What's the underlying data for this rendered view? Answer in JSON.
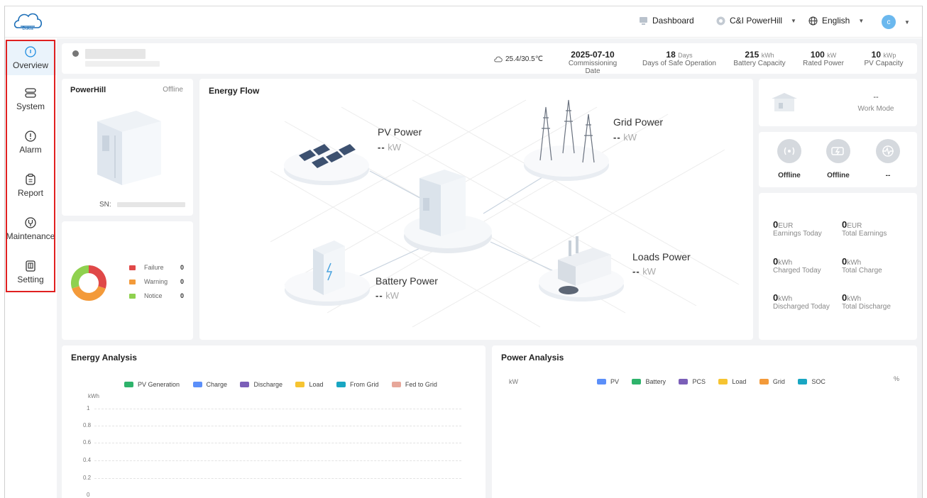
{
  "header": {
    "dashboard_label": "Dashboard",
    "site_label": "C&I PowerHill",
    "language_label": "English",
    "avatar_letter": "c",
    "accent": "#1d8ce0"
  },
  "sidebar": {
    "items": [
      {
        "label": "Overview",
        "icon": "home-icon"
      },
      {
        "label": "System",
        "icon": "system-icon"
      },
      {
        "label": "Alarm",
        "icon": "alarm-icon"
      },
      {
        "label": "Report",
        "icon": "report-icon"
      },
      {
        "label": "Maintenance",
        "icon": "maintenance-icon"
      },
      {
        "label": "Setting",
        "icon": "setting-icon"
      }
    ]
  },
  "info_bar": {
    "weather": "25.4/30.5℃",
    "commissioning_date": "2025-07-10",
    "commissioning_label": "Commissioning Date",
    "safe_days": "18",
    "safe_days_unit": "Days",
    "safe_days_label": "Days of Safe Operation",
    "battery_capacity": "215",
    "battery_capacity_unit": "kWh",
    "battery_capacity_label": "Battery Capacity",
    "rated_power": "100",
    "rated_power_unit": "kW",
    "rated_power_label": "Rated Power",
    "pv_capacity": "10",
    "pv_capacity_unit": "kWp",
    "pv_capacity_label": "PV Capacity"
  },
  "device": {
    "title": "PowerHill",
    "status": "Offline",
    "sn_label": "SN:"
  },
  "alarms": {
    "items": [
      {
        "label": "Failure",
        "count": "0",
        "color": "#e04848"
      },
      {
        "label": "Warning",
        "count": "0",
        "color": "#f39a3a"
      },
      {
        "label": "Notice",
        "count": "0",
        "color": "#8fd14f"
      }
    ]
  },
  "energy_flow": {
    "title": "Energy Flow",
    "pv_label": "PV Power",
    "pv_value": "--",
    "pv_unit": "kW",
    "grid_label": "Grid Power",
    "grid_value": "--",
    "grid_unit": "kW",
    "battery_label": "Battery Power",
    "battery_value": "--",
    "battery_unit": "kW",
    "loads_label": "Loads Power",
    "loads_value": "--",
    "loads_unit": "kW"
  },
  "work_mode": {
    "value": "--",
    "label": "Work Mode"
  },
  "status_icons": [
    {
      "label": "Offline",
      "icon": "signal-icon"
    },
    {
      "label": "Offline",
      "icon": "charger-icon"
    },
    {
      "label": "--",
      "icon": "heartbeat-icon"
    }
  ],
  "stats": {
    "earnings_today": {
      "value": "0",
      "unit": "EUR",
      "label": "Earnings Today"
    },
    "total_earnings": {
      "value": "0",
      "unit": "EUR",
      "label": "Total Earnings"
    },
    "charged_today": {
      "value": "0",
      "unit": "kWh",
      "label": "Charged Today"
    },
    "total_charge": {
      "value": "0",
      "unit": "kWh",
      "label": "Total Charge"
    },
    "discharged_today": {
      "value": "0",
      "unit": "kWh",
      "label": "Discharged Today"
    },
    "total_discharge": {
      "value": "0",
      "unit": "kWh",
      "label": "Total Discharge"
    }
  },
  "energy_analysis": {
    "title": "Energy Analysis",
    "legend": [
      {
        "label": "PV Generation",
        "color": "#2eb36b"
      },
      {
        "label": "Charge",
        "color": "#5b8ff9"
      },
      {
        "label": "Discharge",
        "color": "#7b5fb8"
      },
      {
        "label": "Load",
        "color": "#f6c431"
      },
      {
        "label": "From Grid",
        "color": "#19a6c2"
      },
      {
        "label": "Fed to Grid",
        "color": "#e7a79a"
      }
    ],
    "unit": "kWh",
    "yticks": [
      "1",
      "0.8",
      "0.6",
      "0.4",
      "0.2",
      "0"
    ]
  },
  "power_analysis": {
    "title": "Power Analysis",
    "unit_left": "kW",
    "unit_right": "%",
    "legend": [
      {
        "label": "PV",
        "color": "#5b8ff9"
      },
      {
        "label": "Battery",
        "color": "#2eb36b"
      },
      {
        "label": "PCS",
        "color": "#7b5fb8"
      },
      {
        "label": "Load",
        "color": "#f6c431"
      },
      {
        "label": "Grid",
        "color": "#f39a3a"
      },
      {
        "label": "SOC",
        "color": "#19a6c2"
      }
    ]
  },
  "chart_data": [
    {
      "type": "bar",
      "title": "Energy Analysis",
      "ylabel": "kWh",
      "ylim": [
        0,
        1
      ],
      "yticks": [
        0,
        0.2,
        0.4,
        0.6,
        0.8,
        1
      ],
      "grid": true,
      "legend_position": "top",
      "series": [
        {
          "name": "PV Generation",
          "values": []
        },
        {
          "name": "Charge",
          "values": []
        },
        {
          "name": "Discharge",
          "values": []
        },
        {
          "name": "Load",
          "values": []
        },
        {
          "name": "From Grid",
          "values": []
        },
        {
          "name": "Fed to Grid",
          "values": []
        }
      ]
    },
    {
      "type": "line",
      "title": "Power Analysis",
      "ylabel": "kW",
      "y2label": "%",
      "legend_position": "top",
      "series": [
        {
          "name": "PV",
          "values": []
        },
        {
          "name": "Battery",
          "values": []
        },
        {
          "name": "PCS",
          "values": []
        },
        {
          "name": "Load",
          "values": []
        },
        {
          "name": "Grid",
          "values": []
        },
        {
          "name": "SOC",
          "values": []
        }
      ]
    }
  ]
}
